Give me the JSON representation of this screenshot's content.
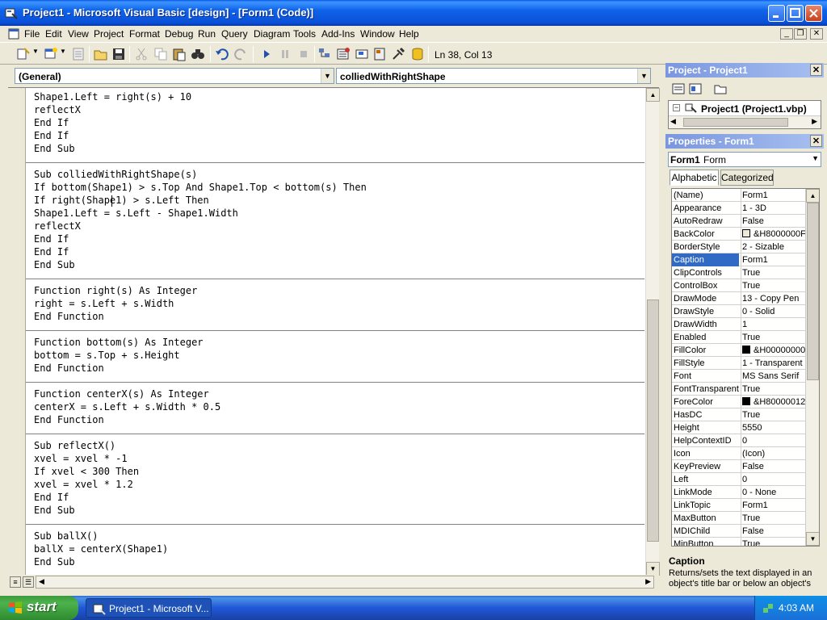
{
  "window": {
    "title": "Project1 - Microsoft Visual Basic [design] - [Form1 (Code)]"
  },
  "menu": [
    "File",
    "Edit",
    "View",
    "Project",
    "Format",
    "Debug",
    "Run",
    "Query",
    "Diagram",
    "Tools",
    "Add-Ins",
    "Window",
    "Help"
  ],
  "toolbar": {
    "position": "Ln 38, Col 13"
  },
  "code_window": {
    "object_combo": "(General)",
    "procedure_combo": "colliedWithRightShape",
    "lines": [
      "Shape1.Left = right(s) + 10",
      "reflectX",
      "End If",
      "End If",
      "End Sub",
      "",
      "Sub colliedWithRightShape(s)",
      "If bottom(Shape1) > s.Top And Shape1.Top < bottom(s) Then",
      "If right(Shape1) > s.Left Then",
      "Shape1.Left = s.Left - Shape1.Width",
      "reflectX",
      "End If",
      "End If",
      "End Sub",
      "",
      "Function right(s) As Integer",
      "right = s.Left + s.Width",
      "End Function",
      "",
      "Function bottom(s) As Integer",
      "bottom = s.Top + s.Height",
      "End Function",
      "",
      "Function centerX(s) As Integer",
      "centerX = s.Left + s.Width * 0.5",
      "End Function",
      "",
      "Sub reflectX()",
      "xvel = xvel * -1",
      "If xvel < 300 Then",
      "xvel = xvel * 1.2",
      "End If",
      "End Sub",
      "",
      "Sub ballX()",
      "ballX = centerX(Shape1)",
      "End Sub"
    ]
  },
  "project_panel": {
    "title": "Project - Project1",
    "tree_item": "Project1 (Project1.vbp)"
  },
  "properties_panel": {
    "title": "Properties - Form1",
    "object": "Form1",
    "object_type": "Form",
    "tabs": [
      "Alphabetic",
      "Categorized"
    ],
    "rows": [
      {
        "name": "(Name)",
        "value": "Form1"
      },
      {
        "name": "Appearance",
        "value": "1 - 3D"
      },
      {
        "name": "AutoRedraw",
        "value": "False"
      },
      {
        "name": "BackColor",
        "value": "&H8000000F",
        "swatch": "#ece9d8"
      },
      {
        "name": "BorderStyle",
        "value": "2 - Sizable"
      },
      {
        "name": "Caption",
        "value": "Form1",
        "selected": true
      },
      {
        "name": "ClipControls",
        "value": "True"
      },
      {
        "name": "ControlBox",
        "value": "True"
      },
      {
        "name": "DrawMode",
        "value": "13 - Copy Pen"
      },
      {
        "name": "DrawStyle",
        "value": "0 - Solid"
      },
      {
        "name": "DrawWidth",
        "value": "1"
      },
      {
        "name": "Enabled",
        "value": "True"
      },
      {
        "name": "FillColor",
        "value": "&H00000000",
        "swatch": "#000000"
      },
      {
        "name": "FillStyle",
        "value": "1 - Transparent"
      },
      {
        "name": "Font",
        "value": "MS Sans Serif"
      },
      {
        "name": "FontTransparent",
        "value": "True"
      },
      {
        "name": "ForeColor",
        "value": "&H80000012",
        "swatch": "#000000"
      },
      {
        "name": "HasDC",
        "value": "True"
      },
      {
        "name": "Height",
        "value": "5550"
      },
      {
        "name": "HelpContextID",
        "value": "0"
      },
      {
        "name": "Icon",
        "value": "(Icon)"
      },
      {
        "name": "KeyPreview",
        "value": "False"
      },
      {
        "name": "Left",
        "value": "0"
      },
      {
        "name": "LinkMode",
        "value": "0 - None"
      },
      {
        "name": "LinkTopic",
        "value": "Form1"
      },
      {
        "name": "MaxButton",
        "value": "True"
      },
      {
        "name": "MDIChild",
        "value": "False"
      },
      {
        "name": "MinButton",
        "value": "True"
      }
    ],
    "description_title": "Caption",
    "description_text": "Returns/sets the text displayed in an object's title bar or below an object's"
  },
  "taskbar": {
    "start_label": "start",
    "task_label": "Project1 - Microsoft V...",
    "clock": "4:03 AM"
  },
  "colors": {
    "selection": "#316ac5",
    "titlebar": "#0a50d8",
    "panel_title": "#7a96df"
  }
}
